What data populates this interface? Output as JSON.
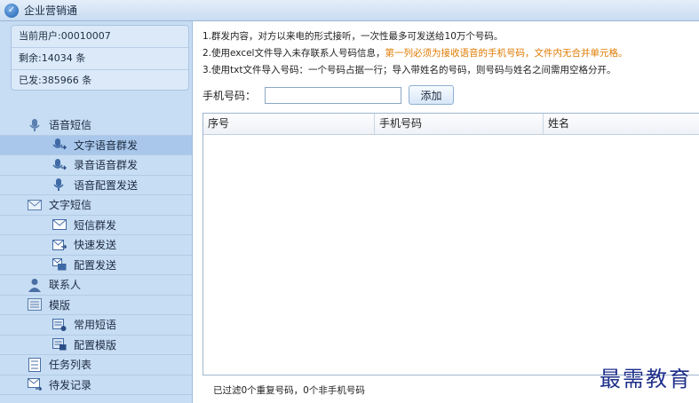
{
  "window": {
    "title": "企业营销通"
  },
  "user": {
    "current_user": "当前用户:00010007",
    "remaining": "剩余:14034 条",
    "sent": "已发:385966 条"
  },
  "nav": {
    "voice_sms": "语音短信",
    "text_voice_group": "文字语音群发",
    "record_voice_group": "录音语音群发",
    "voice_config_send": "语音配置发送",
    "text_sms": "文字短信",
    "sms_group": "短信群发",
    "quick_send": "快速发送",
    "config_send": "配置发送",
    "contacts": "联系人",
    "templates": "模版",
    "common_phrases": "常用短语",
    "config_templates": "配置模版",
    "task_list": "任务列表",
    "pending_records": "待发记录"
  },
  "notes": {
    "line1": "1.群发内容，对方以来电的形式接听，一次性最多可发送给10万个号码。",
    "line2_pre": "2.使用excel文件导入未存联系人号码信息，",
    "line2_hl": "第一列必须为接收语音的手机号码，文件内无合并单元格。",
    "line3": "3.使用txt文件导入号码：一个号码占据一行；导入带姓名的号码，则号码与姓名之间需用空格分开。"
  },
  "phone": {
    "label": "手机号码：",
    "value": "",
    "add_button": "添加"
  },
  "table": {
    "columns": [
      "序号",
      "手机号码",
      "姓名"
    ]
  },
  "footer": {
    "status": "已过滤0个重复号码，0个非手机号码"
  },
  "watermark": "最需教育"
}
